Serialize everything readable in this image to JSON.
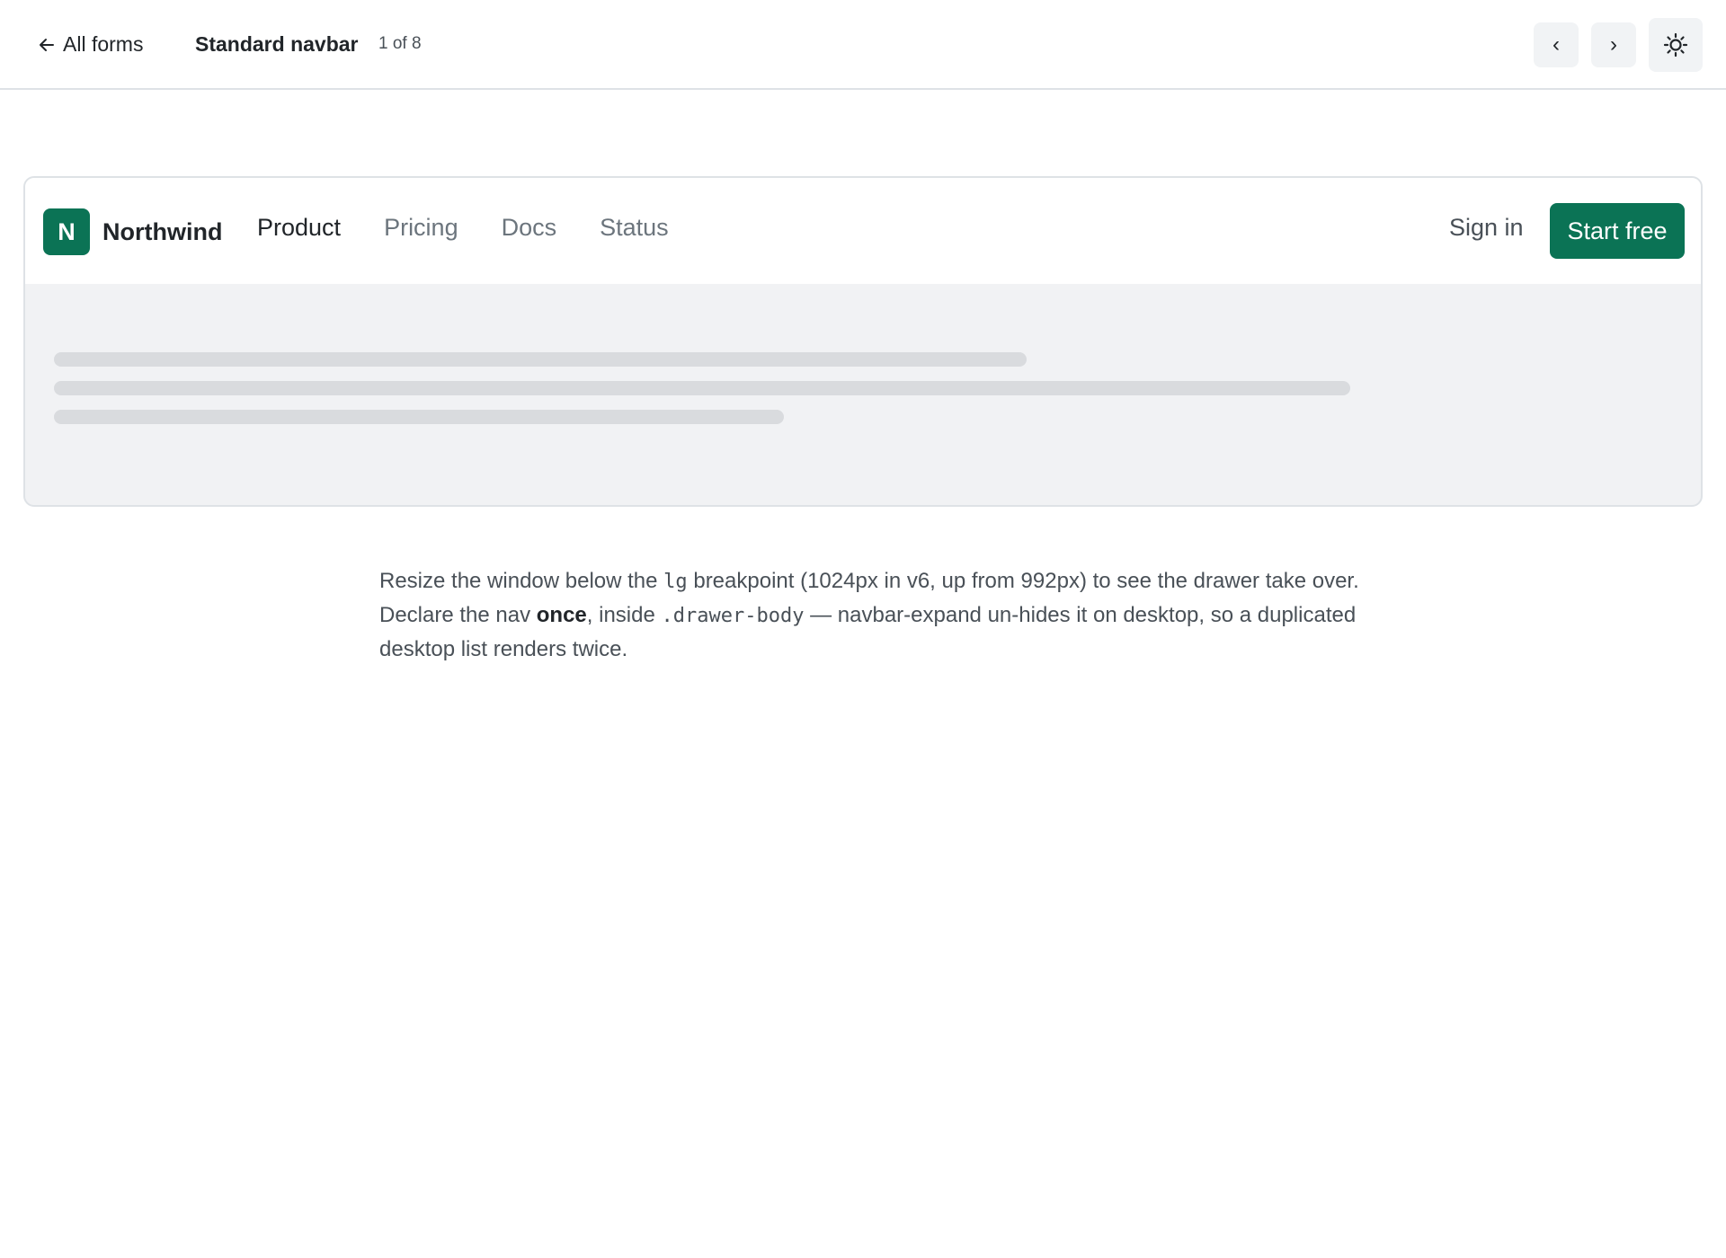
{
  "toolbar": {
    "back_label": "All forms",
    "title": "Standard navbar",
    "counter": "1 of 8",
    "prev_label": "‹",
    "next_label": "›",
    "back_icon": "arrow-left-icon",
    "theme_icon": "sun-icon"
  },
  "demo": {
    "brand_mark": "N",
    "brand_name": "Northwind",
    "nav_items": [
      {
        "label": "Product"
      },
      {
        "label": "Pricing"
      },
      {
        "label": "Docs"
      },
      {
        "label": "Status"
      }
    ],
    "sign_in": "Sign in",
    "cta": "Start free",
    "brand_color": "#0b7355"
  },
  "description": {
    "part1": "Resize the window below the ",
    "code1": "lg",
    "part2": " breakpoint (1024px in v6, up from 992px) to see the drawer take over. Declare the nav ",
    "strong": "once",
    "part3": ", inside ",
    "code2": ".drawer-body",
    "part4": " — navbar-expand un-hides it on desktop, so a duplicated desktop list renders twice."
  }
}
